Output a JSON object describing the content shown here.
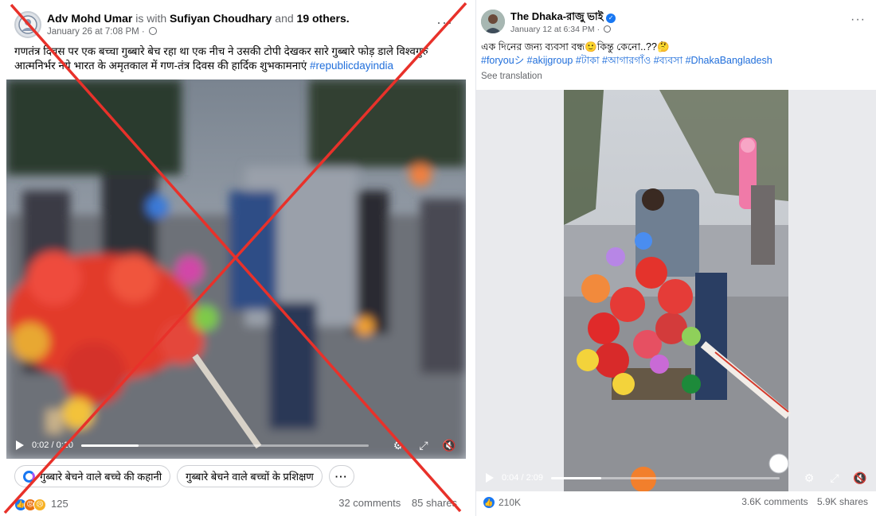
{
  "left_post": {
    "author": "Adv Mohd Umar",
    "with_text": "is with",
    "tagged": "Sufiyan Choudhary",
    "and_text": "and",
    "others": "19 others.",
    "date": "January 26 at 7:08 PM ·",
    "text": "गणतंत्र दिवस पर एक बच्चा गुब्बारे बेच रहा था एक नीच ने उसकी टोपी देखकर सारे गुब्बारे फोड़ डाले विश्वगुरु आत्मनिर्भर नये भारत के अमृतकाल में गण-तंत्र दिवस की हार्दिक शुभकामनाएं",
    "hashtag": "#republicdayindia",
    "video_time": "0:02 / 0:10",
    "video_progress": 0.2,
    "chips": [
      "गुब्बारे बेचने वाले बच्चे की कहानी",
      "गुब्बारे बेचने वाले बच्चों के प्रशिक्षण"
    ],
    "more_chip": "···",
    "reactions_count": "125",
    "comments": "32 comments",
    "shares": "85 shares",
    "more_dots": "···"
  },
  "right_post": {
    "page_name": "The Dhaka-রাজু ভাই",
    "date": "January 12 at 6:34 PM ·",
    "text": "এক দিনের জন্য ব্যবসা বন্ধ🙂কিন্তু কেনো..??🤔",
    "hashtags": "#foryouシ #akijgroup #টাকা #আগারগাঁও #ব্যবসা #DhakaBangladesh",
    "see_translation": "See translation",
    "video_time": "0:04 / 2:09",
    "video_progress": 0.22,
    "reactions_count": "210K",
    "comments": "3.6K comments",
    "shares": "5.9K shares",
    "more_dots": "···"
  },
  "colors": {
    "cross": "#e8312a",
    "link": "#216fdb",
    "like_blue": "#1877f2"
  }
}
